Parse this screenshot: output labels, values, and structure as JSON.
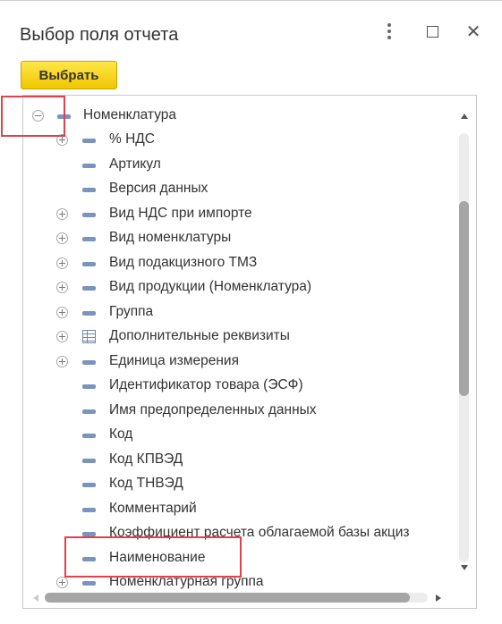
{
  "window": {
    "title": "Выбор поля отчета",
    "more_icon": "more-vertical-icon",
    "maximize_icon": "maximize-icon",
    "close_icon": "close-icon",
    "close_glyph": "✕"
  },
  "toolbar": {
    "select_label": "Выбрать"
  },
  "tree": {
    "items": [
      {
        "label": "Номенклатура",
        "expander": "minus",
        "icon": "field-icon"
      },
      {
        "label": "% НДС",
        "expander": "plus",
        "icon": "field-icon"
      },
      {
        "label": "Артикул",
        "expander": "none",
        "icon": "field-icon"
      },
      {
        "label": "Версия данных",
        "expander": "none",
        "icon": "field-icon"
      },
      {
        "label": "Вид НДС при импорте",
        "expander": "plus",
        "icon": "field-icon"
      },
      {
        "label": "Вид номенклатуры",
        "expander": "plus",
        "icon": "field-icon"
      },
      {
        "label": "Вид подакцизного ТМЗ",
        "expander": "plus",
        "icon": "field-icon"
      },
      {
        "label": "Вид продукции (Номенклатура)",
        "expander": "plus",
        "icon": "field-icon"
      },
      {
        "label": "Группа",
        "expander": "plus",
        "icon": "field-icon"
      },
      {
        "label": "Дополнительные реквизиты",
        "expander": "plus",
        "icon": "table-icon"
      },
      {
        "label": "Единица измерения",
        "expander": "plus",
        "icon": "field-icon"
      },
      {
        "label": "Идентификатор товара (ЭСФ)",
        "expander": "none",
        "icon": "field-icon"
      },
      {
        "label": "Имя предопределенных данных",
        "expander": "none",
        "icon": "field-icon"
      },
      {
        "label": "Код",
        "expander": "none",
        "icon": "field-icon"
      },
      {
        "label": "Код КПВЭД",
        "expander": "none",
        "icon": "field-icon"
      },
      {
        "label": "Код ТНВЭД",
        "expander": "none",
        "icon": "field-icon"
      },
      {
        "label": "Комментарий",
        "expander": "none",
        "icon": "field-icon"
      },
      {
        "label": "Коэффициент расчета облагаемой базы акциз",
        "expander": "none",
        "icon": "field-icon"
      },
      {
        "label": "Наименование",
        "expander": "none",
        "icon": "field-icon"
      },
      {
        "label": "Номенклатурная группа",
        "expander": "plus",
        "icon": "field-icon"
      }
    ]
  },
  "colors": {
    "button_bg": "#f5d000",
    "field_icon": "#7b94bd",
    "highlight": "#e0414a"
  }
}
